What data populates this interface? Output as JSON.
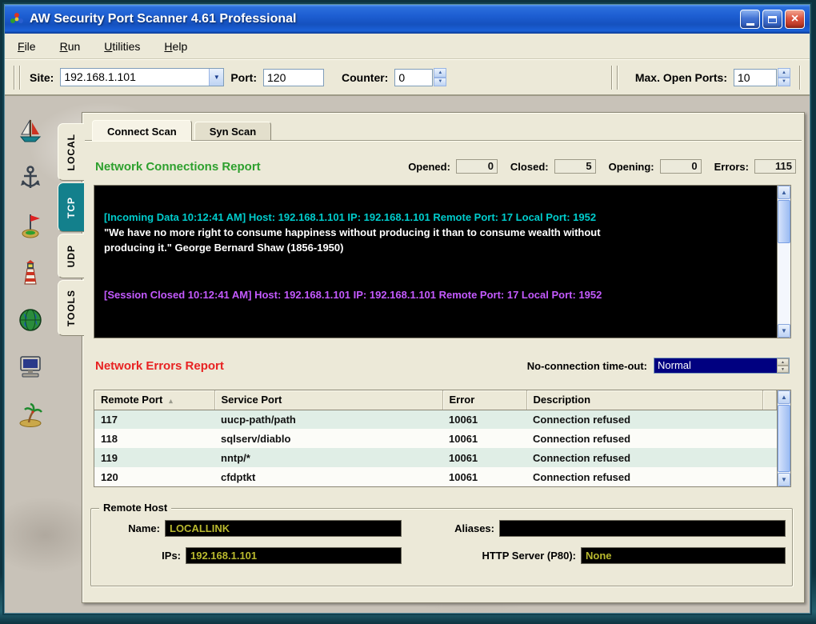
{
  "colors": {
    "titlebar_blue": "#1d5ed2",
    "tab_selected_teal": "#13808c",
    "heading_green": "#2ea02e",
    "heading_red": "#e82222",
    "log_incoming": "#00cccc",
    "log_message": "#ffffff",
    "log_closed": "#c45aff",
    "black_field_text": "#b9b92e",
    "highlight_navy": "#000080",
    "row_stripe_green": "#e0eee6"
  },
  "window": {
    "title": "AW Security Port Scanner 4.61 Professional",
    "close_glyph": "×"
  },
  "menu": {
    "items": [
      "File",
      "Run",
      "Utilities",
      "Help"
    ]
  },
  "toolbar": {
    "site_label": "Site:",
    "site_value": "192.168.1.101",
    "port_label": "Port:",
    "port_value": "120",
    "counter_label": "Counter:",
    "counter_value": "0",
    "max_open_ports_label": "Max. Open Ports:",
    "max_open_ports_value": "10"
  },
  "nav_icons": [
    "sailboat",
    "anchor",
    "buoy",
    "lighthouse",
    "globe",
    "computer",
    "palm-island"
  ],
  "side_tabs": [
    {
      "label": "LOCAL"
    },
    {
      "label": "TCP",
      "selected": true
    },
    {
      "label": "UDP"
    },
    {
      "label": "TOOLS"
    }
  ],
  "scan_tabs": [
    {
      "label": "Connect Scan",
      "active": true
    },
    {
      "label": "Syn Scan"
    }
  ],
  "connections_report": {
    "title": "Network Connections Report",
    "opened_label": "Opened:",
    "opened_value": "0",
    "closed_label": "Closed:",
    "closed_value": "5",
    "opening_label": "Opening:",
    "opening_value": "0",
    "errors_label": "Errors:",
    "errors_value": "115",
    "log": [
      {
        "type": "incoming",
        "text": "[Incoming Data 10:12:41 AM] Host: 192.168.1.101 IP: 192.168.1.101 Remote Port: 17 Local Port: 1952"
      },
      {
        "type": "message",
        "text": "\"We have no more right to consume happiness without producing it than to consume wealth without producing it.\" George Bernard Shaw (1856-1950)"
      },
      {
        "type": "closed",
        "text": "[Session Closed 10:12:41 AM] Host: 192.168.1.101 IP: 192.168.1.101 Remote Port: 17 Local Port: 1952"
      }
    ]
  },
  "errors_report": {
    "title": "Network Errors Report",
    "timeout_label": "No-connection time-out:",
    "timeout_value": "Normal",
    "columns": [
      "Remote Port",
      "Service Port",
      "Error",
      "Description"
    ],
    "rows": [
      [
        "117",
        "uucp-path/path",
        "10061",
        "Connection refused"
      ],
      [
        "118",
        "sqlserv/diablo",
        "10061",
        "Connection refused"
      ],
      [
        "119",
        "nntp/*",
        "10061",
        "Connection refused"
      ],
      [
        "120",
        "cfdptkt",
        "10061",
        "Connection refused"
      ]
    ]
  },
  "remote_host": {
    "title": "Remote Host",
    "name_label": "Name:",
    "name_value": "LOCALLINK",
    "aliases_label": "Aliases:",
    "aliases_value": "",
    "ips_label": "IPs:",
    "ips_value": "192.168.1.101",
    "http_label": "HTTP Server (P80):",
    "http_value": "None"
  },
  "icons": {
    "up_arrow": "▲",
    "down_arrow": "▼",
    "dropdown_arrow": "▼",
    "sort": "▴"
  }
}
